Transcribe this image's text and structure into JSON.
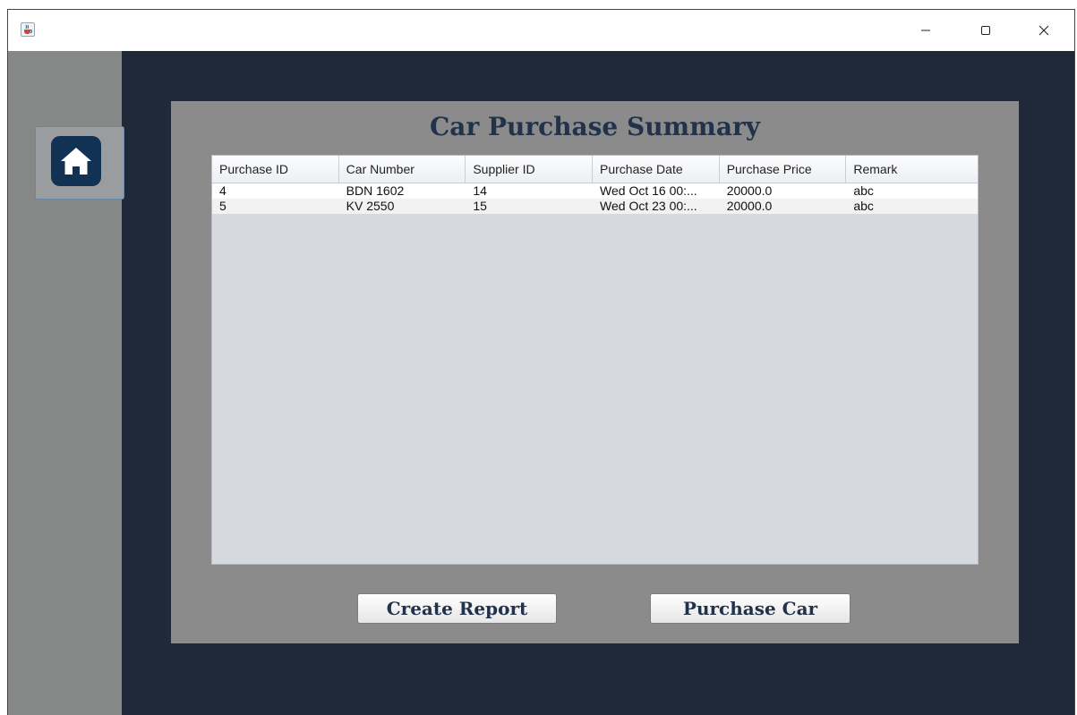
{
  "window": {
    "app_icon": "java-cup-icon",
    "controls": {
      "minimize": "minimize-icon",
      "maximize": "maximize-icon",
      "close": "close-icon"
    }
  },
  "sidebar": {
    "home_icon": "home-icon"
  },
  "main": {
    "title": "Car Purchase Summary",
    "table": {
      "columns": [
        "Purchase ID",
        "Car Number",
        "Supplier ID",
        "Purchase Date",
        "Purchase Price",
        "Remark"
      ],
      "rows": [
        [
          "4",
          "BDN 1602",
          "14",
          "Wed Oct 16 00:...",
          "20000.0",
          "abc"
        ],
        [
          "5",
          "KV 2550",
          "15",
          "Wed Oct 23 00:...",
          "20000.0",
          "abc"
        ]
      ]
    },
    "buttons": {
      "create_report": "Create Report",
      "purchase_car": "Purchase Car"
    }
  },
  "colors": {
    "window_bg": "#1f2937",
    "sidebar_bg": "#868887",
    "panel_bg": "#8a8b8a",
    "title_text": "#22324a",
    "home_tile": "#123253",
    "table_bg": "#d6d9e0"
  }
}
